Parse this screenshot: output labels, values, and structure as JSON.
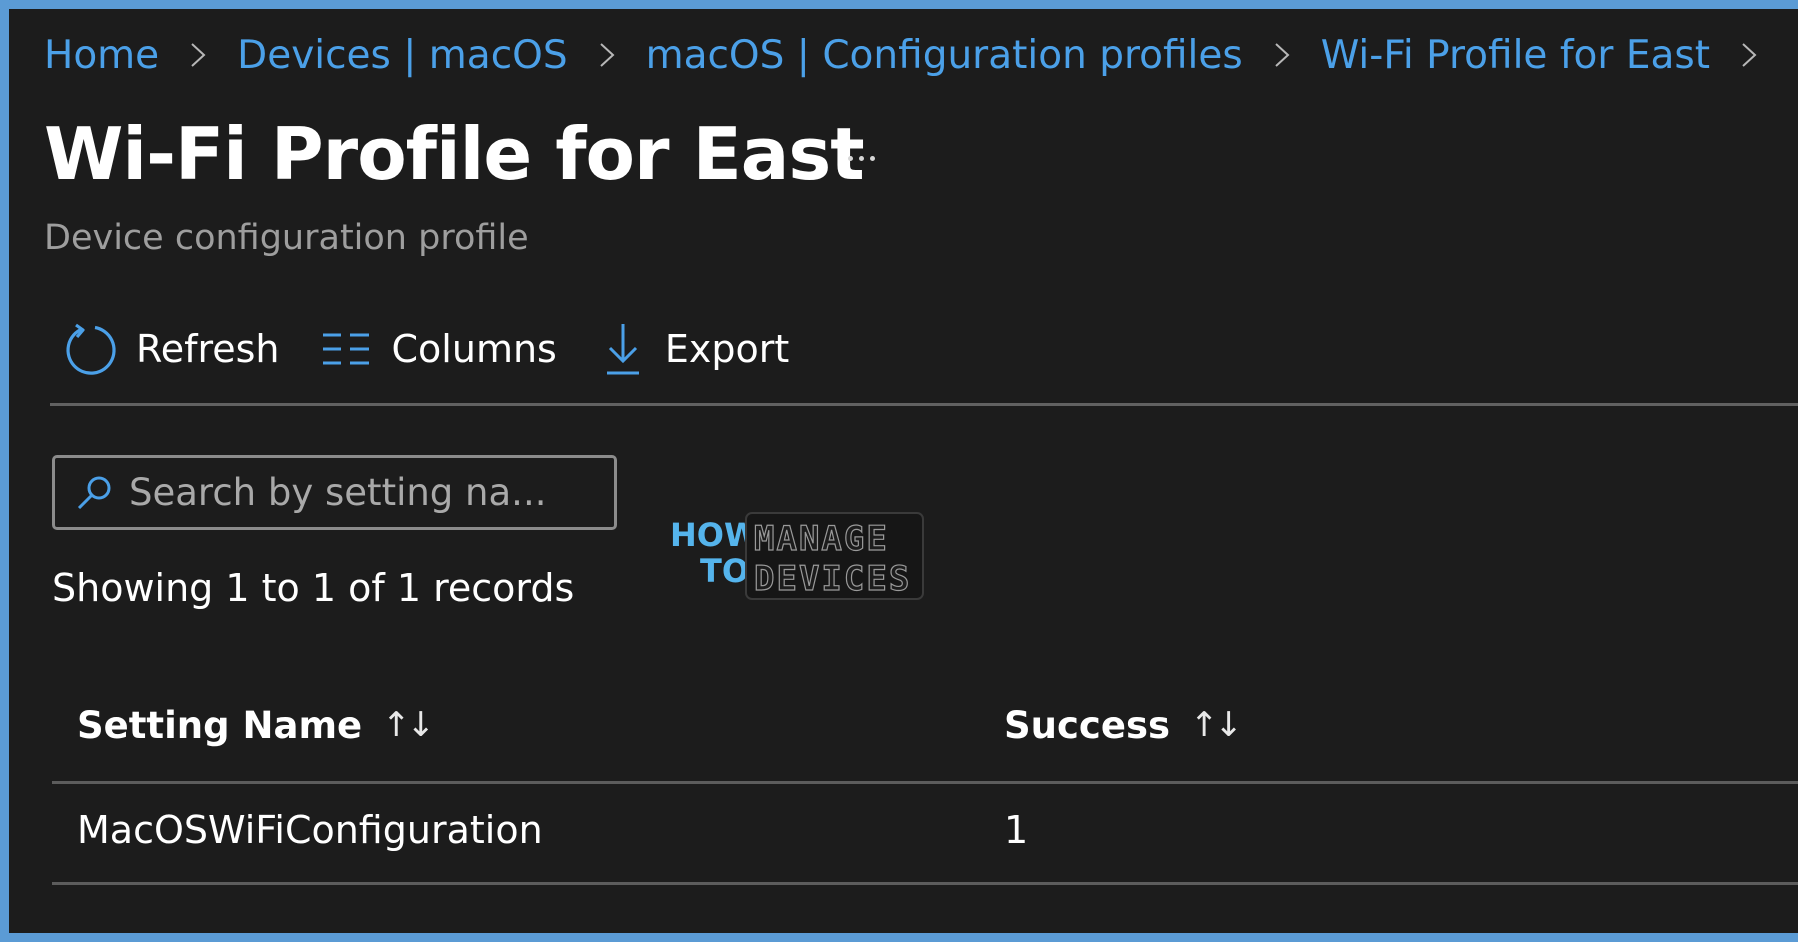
{
  "colors": {
    "border": "#5b9bd5",
    "background": "#1c1c1c",
    "link": "#4ba0e8",
    "text": "#ffffff",
    "muted": "#9e9e9e"
  },
  "breadcrumb": [
    {
      "label": "Home"
    },
    {
      "label": "Devices | macOS"
    },
    {
      "label": "macOS | Configuration profiles"
    },
    {
      "label": "Wi-Fi Profile for East"
    }
  ],
  "header": {
    "title": "Wi-Fi Profile for East",
    "more_icon": "ellipsis-icon",
    "subtitle": "Device configuration profile"
  },
  "toolbar": {
    "refresh": {
      "label": "Refresh",
      "icon": "refresh-icon"
    },
    "columns": {
      "label": "Columns",
      "icon": "columns-icon"
    },
    "export": {
      "label": "Export",
      "icon": "download-icon"
    }
  },
  "search": {
    "placeholder": "Search by setting na...",
    "value": "",
    "icon": "search-icon"
  },
  "records_text": "Showing 1 to 1 of 1 records",
  "watermark": {
    "line1": "HOW",
    "line2": "TO",
    "word1": "MANAGE",
    "word2": "DEVICES"
  },
  "table": {
    "columns": [
      {
        "label": "Setting Name",
        "sort_icon": "↑↓"
      },
      {
        "label": "Success",
        "sort_icon": "↑↓"
      }
    ],
    "rows": [
      {
        "setting_name": "MacOSWiFiConfiguration",
        "success": "1"
      }
    ]
  }
}
